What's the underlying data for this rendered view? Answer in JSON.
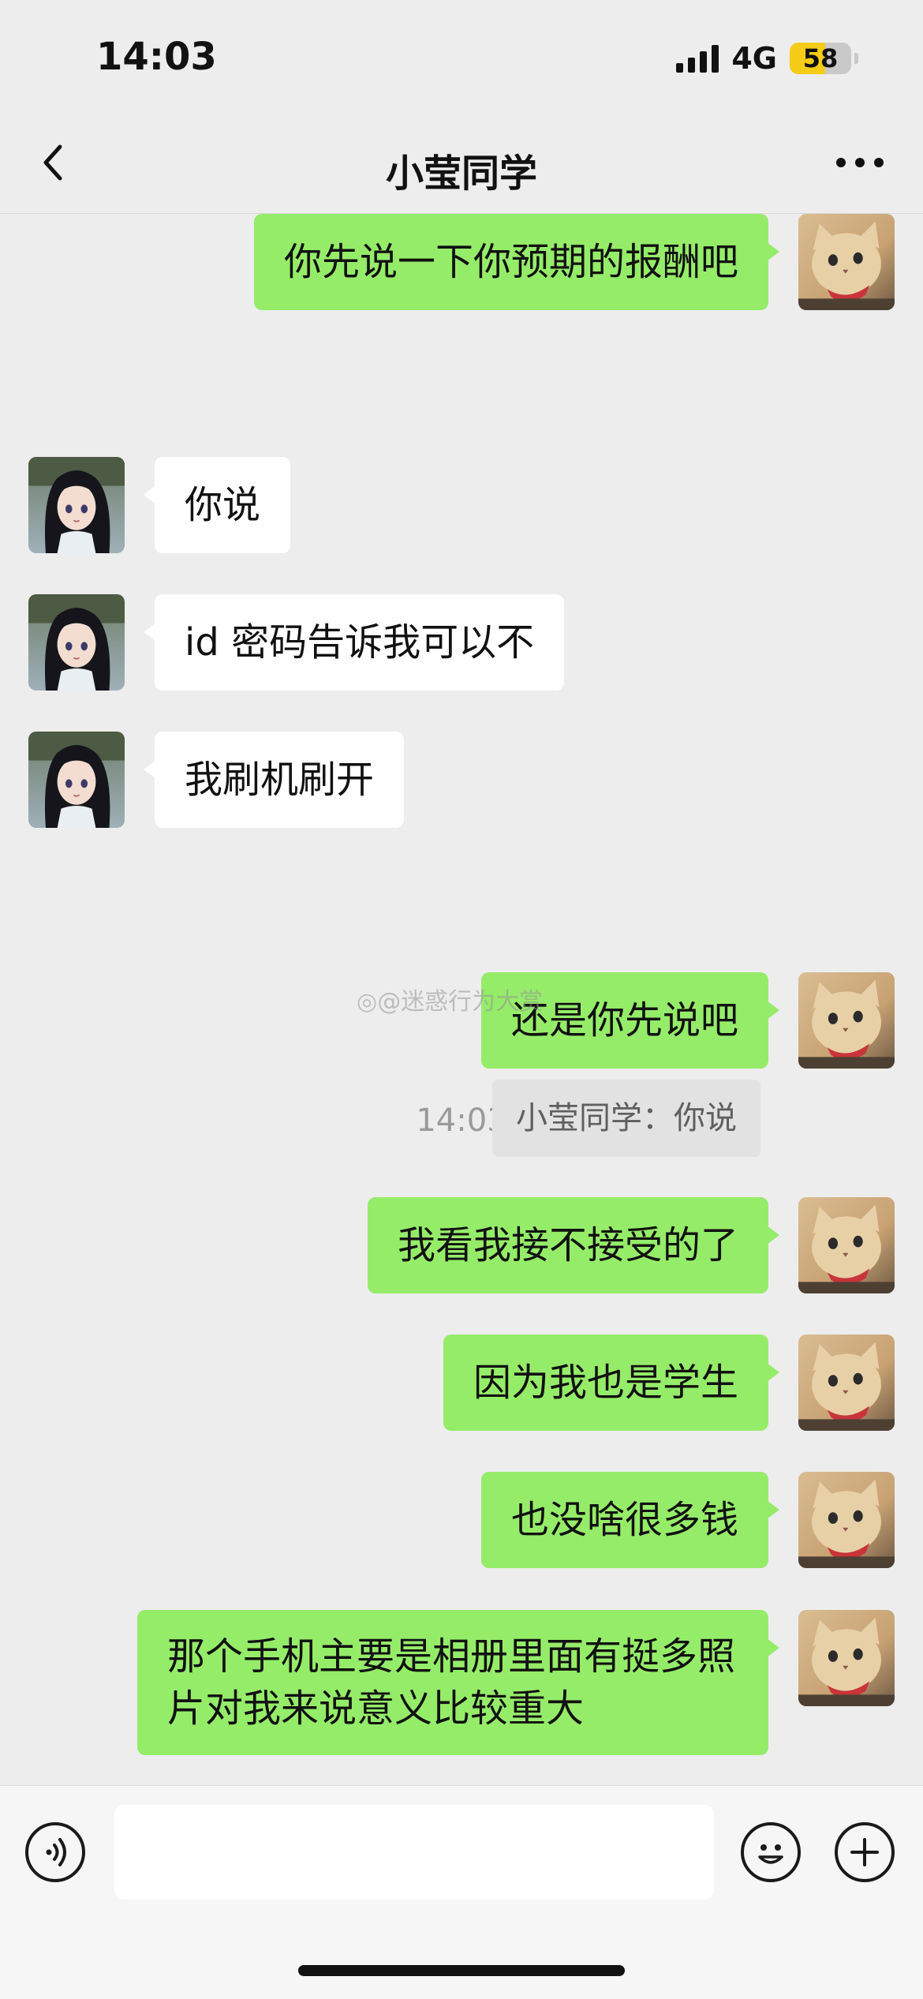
{
  "status_bar": {
    "time": "14:03",
    "network": "4G",
    "battery": "58",
    "battery_level": 0.58
  },
  "header": {
    "title": "小莹同学",
    "back_icon": "chevron-left-icon",
    "more_icon": "more-dots-icon"
  },
  "messages": [
    {
      "sender": "me",
      "text": "你先说一下你预期的报酬吧"
    },
    {
      "sender": "other",
      "text": "你说"
    },
    {
      "sender": "other",
      "text": "id 密码告诉我可以不"
    },
    {
      "sender": "other",
      "text": "我刷机刷开"
    },
    {
      "sender": "me",
      "text": "还是你先说吧",
      "quote": "小莹同学：你说"
    },
    {
      "sender": "me",
      "text": "我看我接不接受的了"
    },
    {
      "sender": "me",
      "text": "因为我也是学生"
    },
    {
      "sender": "me",
      "text": "也没啥很多钱"
    },
    {
      "sender": "me",
      "text": "那个手机主要是相册里面有挺多照片对我来说意义比较重大"
    }
  ],
  "timestamp": "14:03",
  "watermark": "@迷惑行为大赏",
  "input_bar": {
    "voice_icon": "voice-icon",
    "emoji_icon": "emoji-icon",
    "plus_icon": "plus-icon",
    "value": ""
  },
  "colors": {
    "my_bubble": "#95ec69",
    "their_bubble": "#ffffff",
    "background": "#ededed",
    "battery": "#f5cc17"
  }
}
